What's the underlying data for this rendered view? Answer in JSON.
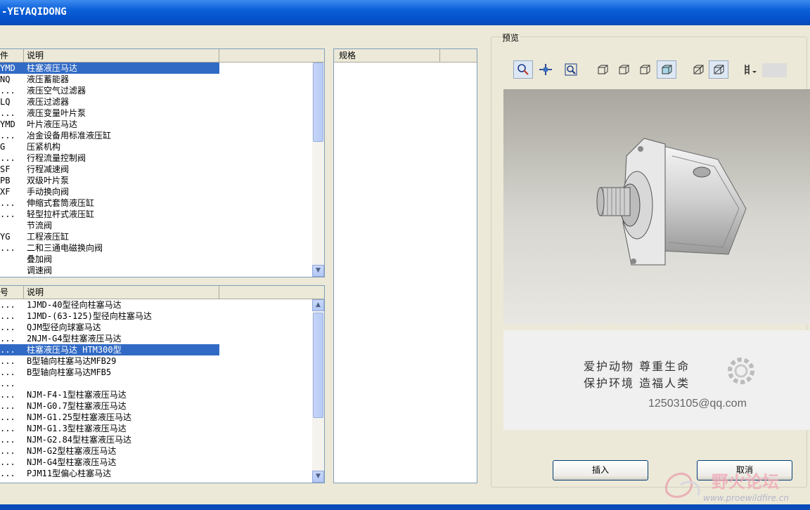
{
  "window": {
    "title": "-YEYAQIDONG"
  },
  "top_list": {
    "columns": [
      "件",
      "说明"
    ],
    "rows": [
      {
        "code": "YMD",
        "desc": "柱塞液压马达",
        "selected": true
      },
      {
        "code": "NQ",
        "desc": "液压蓄能器"
      },
      {
        "code": "...",
        "desc": "液压空气过滤器"
      },
      {
        "code": "LQ",
        "desc": "液压过滤器"
      },
      {
        "code": "...",
        "desc": "液压变量叶片泵"
      },
      {
        "code": "YMD",
        "desc": "叶片液压马达"
      },
      {
        "code": "...",
        "desc": "冶金设备用标准液压缸"
      },
      {
        "code": "G",
        "desc": "压紧机构"
      },
      {
        "code": "...",
        "desc": "行程流量控制阀"
      },
      {
        "code": "SF",
        "desc": "行程减速阀"
      },
      {
        "code": "PB",
        "desc": "双级叶片泵"
      },
      {
        "code": "XF",
        "desc": "手动换向阀"
      },
      {
        "code": "...",
        "desc": "伸缩式套筒液压缸"
      },
      {
        "code": "...",
        "desc": "轻型拉杆式液压缸"
      },
      {
        "code": "",
        "desc": "节流阀"
      },
      {
        "code": "YG",
        "desc": "工程液压缸"
      },
      {
        "code": "...",
        "desc": "二和三通电磁换向阀"
      },
      {
        "code": "",
        "desc": "叠加阀"
      },
      {
        "code": "",
        "desc": "调速阀"
      }
    ]
  },
  "bottom_list": {
    "columns": [
      "号",
      "说明"
    ],
    "rows": [
      {
        "code": "...",
        "desc": "1JMD-40型径向柱塞马达"
      },
      {
        "code": "...",
        "desc": "1JMD-(63-125)型径向柱塞马达"
      },
      {
        "code": "...",
        "desc": "QJM型径向球塞马达"
      },
      {
        "code": "...",
        "desc": "2NJM-G4型柱塞液压马达"
      },
      {
        "code": "...",
        "desc": "柱塞液压马达 HTM300型",
        "selected": true
      },
      {
        "code": "...",
        "desc": "B型轴向柱塞马达MFB29"
      },
      {
        "code": "...",
        "desc": "B型轴向柱塞马达MFB5"
      },
      {
        "code": "...",
        "desc": ""
      },
      {
        "code": "...",
        "desc": "NJM-F4-1型柱塞液压马达"
      },
      {
        "code": "...",
        "desc": "NJM-G0.7型柱塞液压马达"
      },
      {
        "code": "...",
        "desc": "NJM-G1.25型柱塞液压马达"
      },
      {
        "code": "...",
        "desc": "NJM-G1.3型柱塞液压马达"
      },
      {
        "code": "...",
        "desc": "NJM-G2.84型柱塞液压马达"
      },
      {
        "code": "...",
        "desc": "NJM-G2型柱塞液压马达"
      },
      {
        "code": "...",
        "desc": "NJM-G4型柱塞液压马达"
      },
      {
        "code": "...",
        "desc": "PJM11型偏心柱塞马达"
      }
    ]
  },
  "spec_list": {
    "columns": [
      "规格"
    ]
  },
  "preview": {
    "label": "预览",
    "motto_line1": "爱护动物  尊重生命",
    "motto_line2": "保护环境  造福人类",
    "email": "12503105@qq.com"
  },
  "buttons": {
    "insert": "插入",
    "cancel": "取消"
  },
  "watermark": {
    "site_name": "野火论坛",
    "url": "www.proewildfire.cn"
  },
  "colors": {
    "selection": "#316ac5",
    "titlebar": "#0a5fd8"
  }
}
